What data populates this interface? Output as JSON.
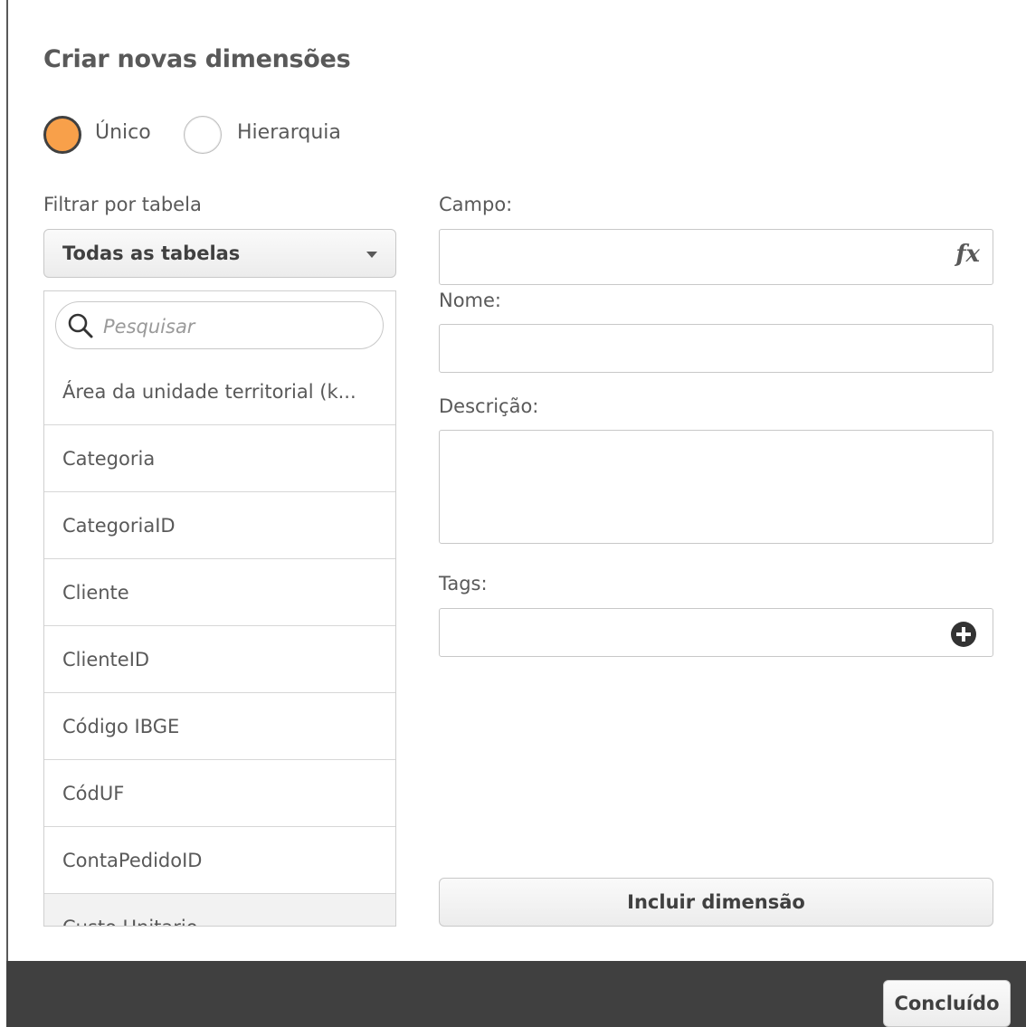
{
  "dialog": {
    "title": "Criar novas dimensões"
  },
  "mode": {
    "options": [
      {
        "label": "Único",
        "selected": true
      },
      {
        "label": "Hierarquia",
        "selected": false
      }
    ],
    "accent_color": "#f8a04a"
  },
  "filter": {
    "label": "Filtrar por tabela",
    "selected": "Todas as tabelas"
  },
  "search": {
    "placeholder": "Pesquisar",
    "value": ""
  },
  "fields": {
    "items": [
      "Área da unidade territorial (k...",
      "Categoria",
      "CategoriaID",
      "Cliente",
      "ClienteID",
      "Código IBGE",
      "CódUF",
      "ContaPedidoID",
      "Custo Unitario"
    ]
  },
  "form": {
    "campo_label": "Campo:",
    "campo_value": "",
    "campo_icon": "fx-icon",
    "nome_label": "Nome:",
    "nome_value": "",
    "descricao_label": "Descrição:",
    "descricao_value": "",
    "tags_label": "Tags:",
    "tags_value": "",
    "tags_icon": "plus-circle-icon",
    "include_button": "Incluir dimensão"
  },
  "footer": {
    "done_button": "Concluído",
    "background_color": "#404040"
  }
}
